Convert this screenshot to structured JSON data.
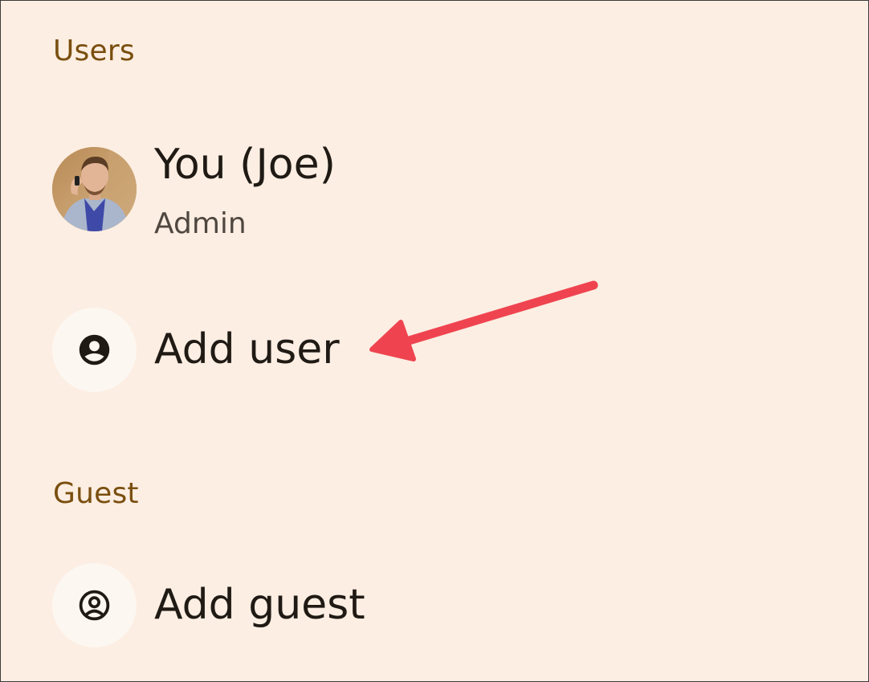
{
  "sections": {
    "users": {
      "header": "Users",
      "current_user": {
        "name": "You (Joe)",
        "role": "Admin"
      },
      "add_user_label": "Add user"
    },
    "guest": {
      "header": "Guest",
      "add_guest_label": "Add guest"
    }
  },
  "icons": {
    "add_user": "account-circle-icon",
    "add_guest": "account-circle-outline-icon",
    "avatar": "user-avatar-photo"
  },
  "colors": {
    "background": "#FCEEE2",
    "section_header": "#7A4E0F",
    "title_text": "#201A15",
    "subtitle_text": "#4F4740",
    "icon_circle": "#FDF7F2",
    "annotation_arrow": "#EF4450"
  }
}
